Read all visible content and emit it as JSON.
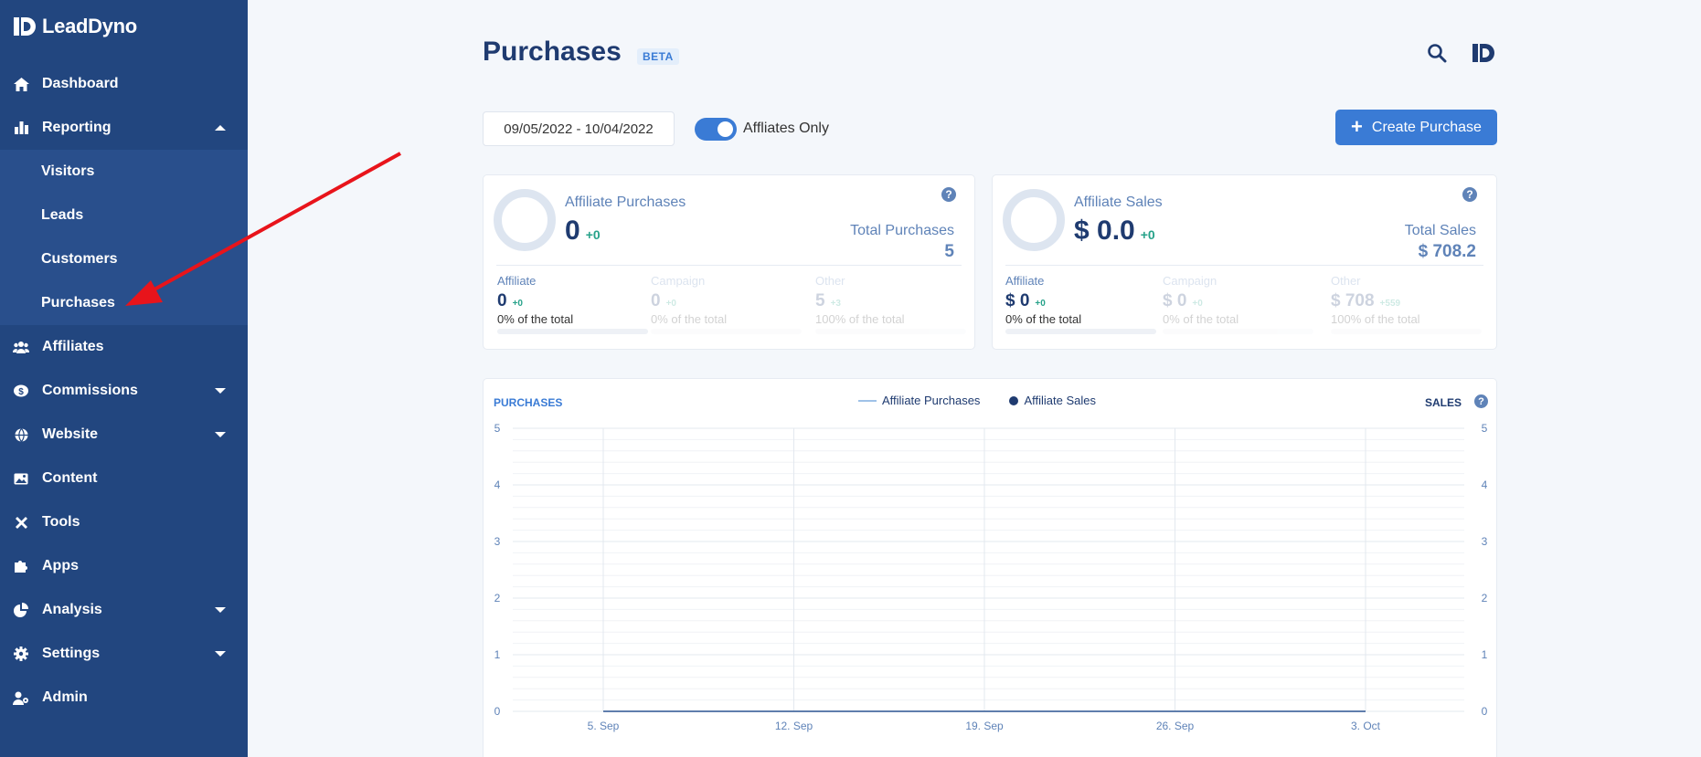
{
  "brand": {
    "name": "LeadDyno"
  },
  "sidebar": {
    "items": [
      {
        "label": "Dashboard",
        "icon": "home-icon"
      },
      {
        "label": "Reporting",
        "icon": "bar-chart-icon",
        "expanded": true
      },
      {
        "label": "Affiliates",
        "icon": "users-icon"
      },
      {
        "label": "Commissions",
        "icon": "dollar-badge-icon"
      },
      {
        "label": "Website",
        "icon": "globe-icon"
      },
      {
        "label": "Content",
        "icon": "image-icon"
      },
      {
        "label": "Tools",
        "icon": "tools-icon"
      },
      {
        "label": "Apps",
        "icon": "puzzle-icon"
      },
      {
        "label": "Analysis",
        "icon": "pie-chart-icon"
      },
      {
        "label": "Settings",
        "icon": "gear-icon"
      },
      {
        "label": "Admin",
        "icon": "user-cog-icon"
      }
    ],
    "reporting_sub": [
      "Visitors",
      "Leads",
      "Customers",
      "Purchases"
    ]
  },
  "header": {
    "title": "Purchases",
    "badge": "BETA"
  },
  "toolbar": {
    "date_range": "09/05/2022 - 10/04/2022",
    "affiliates_only_label": "Affliates Only",
    "affiliates_only": true,
    "create_label": "Create Purchase"
  },
  "purchases_card": {
    "title": "Affiliate Purchases",
    "value": "0",
    "delta": "+0",
    "total_label": "Total Purchases",
    "total_value": "5",
    "columns": [
      {
        "label": "Affiliate",
        "value": "0",
        "delta": "+0",
        "pct": "0% of the total",
        "fill": 0
      },
      {
        "label": "Campaign",
        "value": "0",
        "delta": "+0",
        "pct": "0% of the total",
        "fill": 0
      },
      {
        "label": "Other",
        "value": "5",
        "delta": "+3",
        "pct": "100% of the total",
        "fill": 1
      }
    ]
  },
  "sales_card": {
    "title": "Affiliate Sales",
    "value": "$ 0.0",
    "delta": "+0",
    "total_label": "Total Sales",
    "total_value": "$ 708.2",
    "columns": [
      {
        "label": "Affiliate",
        "value": "$ 0",
        "delta": "+0",
        "pct": "0% of the total",
        "fill": 0
      },
      {
        "label": "Campaign",
        "value": "$ 0",
        "delta": "+0",
        "pct": "0% of the total",
        "fill": 0
      },
      {
        "label": "Other",
        "value": "$ 708",
        "delta": "+559",
        "pct": "100% of the total",
        "fill": 1
      }
    ]
  },
  "chart_data": {
    "type": "line",
    "title_left": "PURCHASES",
    "title_right": "SALES",
    "legend": [
      "Affiliate Purchases",
      "Affiliate Sales"
    ],
    "x_ticks": [
      "5. Sep",
      "12. Sep",
      "19. Sep",
      "26. Sep",
      "3. Oct"
    ],
    "y_ticks": [
      "0",
      "1",
      "2",
      "3",
      "4",
      "5"
    ],
    "ylim": [
      0,
      5
    ],
    "series": [
      {
        "name": "Affiliate Purchases",
        "values": [
          0,
          0,
          0,
          0,
          0
        ]
      },
      {
        "name": "Affiliate Sales",
        "values": [
          0,
          0,
          0,
          0,
          0
        ]
      }
    ],
    "colors": {
      "purchases": "#9fc2e8",
      "sales": "#1f3b70"
    }
  }
}
